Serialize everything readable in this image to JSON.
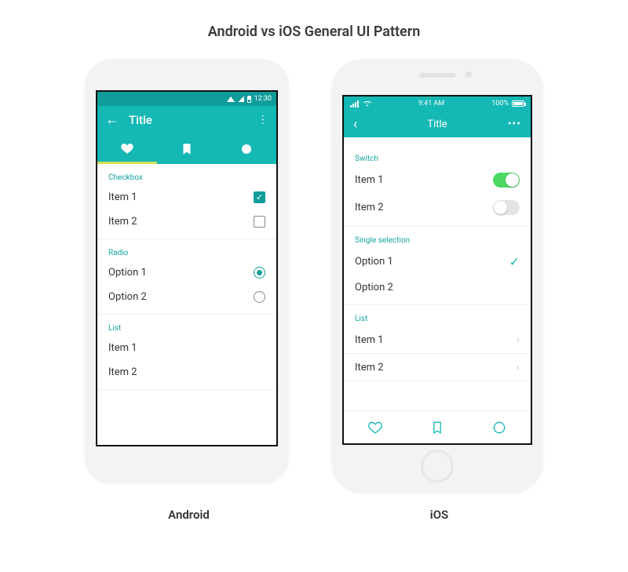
{
  "page_title": "Android vs iOS General UI Pattern",
  "labels": {
    "android": "Android",
    "ios": "iOS"
  },
  "android": {
    "status": {
      "time": "12:30"
    },
    "appbar": {
      "title": "Title"
    },
    "sections": {
      "checkbox": {
        "heading": "Checkbox",
        "items": [
          {
            "label": "Item 1",
            "checked": true
          },
          {
            "label": "Item 2",
            "checked": false
          }
        ]
      },
      "radio": {
        "heading": "Radio",
        "items": [
          {
            "label": "Option 1",
            "selected": true
          },
          {
            "label": "Option 2",
            "selected": false
          }
        ]
      },
      "list": {
        "heading": "List",
        "items": [
          {
            "label": "Item 1"
          },
          {
            "label": "Item 2"
          }
        ]
      }
    }
  },
  "ios": {
    "status": {
      "time": "9:41 AM",
      "battery": "100%"
    },
    "navbar": {
      "title": "Title"
    },
    "sections": {
      "switch": {
        "heading": "Switch",
        "items": [
          {
            "label": "Item 1",
            "on": true
          },
          {
            "label": "Item 2",
            "on": false
          }
        ]
      },
      "single": {
        "heading": "Single selection",
        "items": [
          {
            "label": "Option 1",
            "selected": true
          },
          {
            "label": "Option 2",
            "selected": false
          }
        ]
      },
      "list": {
        "heading": "List",
        "items": [
          {
            "label": "Item 1"
          },
          {
            "label": "Item 2"
          }
        ]
      }
    }
  }
}
